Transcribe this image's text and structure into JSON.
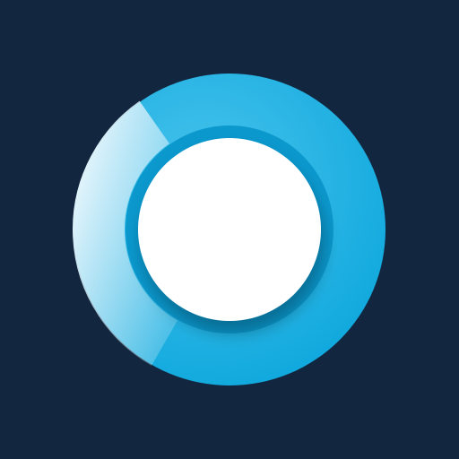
{
  "app_icon": {
    "icon": "progress-ring-icon",
    "progress_fraction": 0.32,
    "colors": {
      "background": "#13263f",
      "ring": "#0aa6dc",
      "ring_highlight": "#49c3ec",
      "progress_arc": "#dff3fb",
      "inner_track": "#0b98cd",
      "center": "#ffffff"
    }
  }
}
